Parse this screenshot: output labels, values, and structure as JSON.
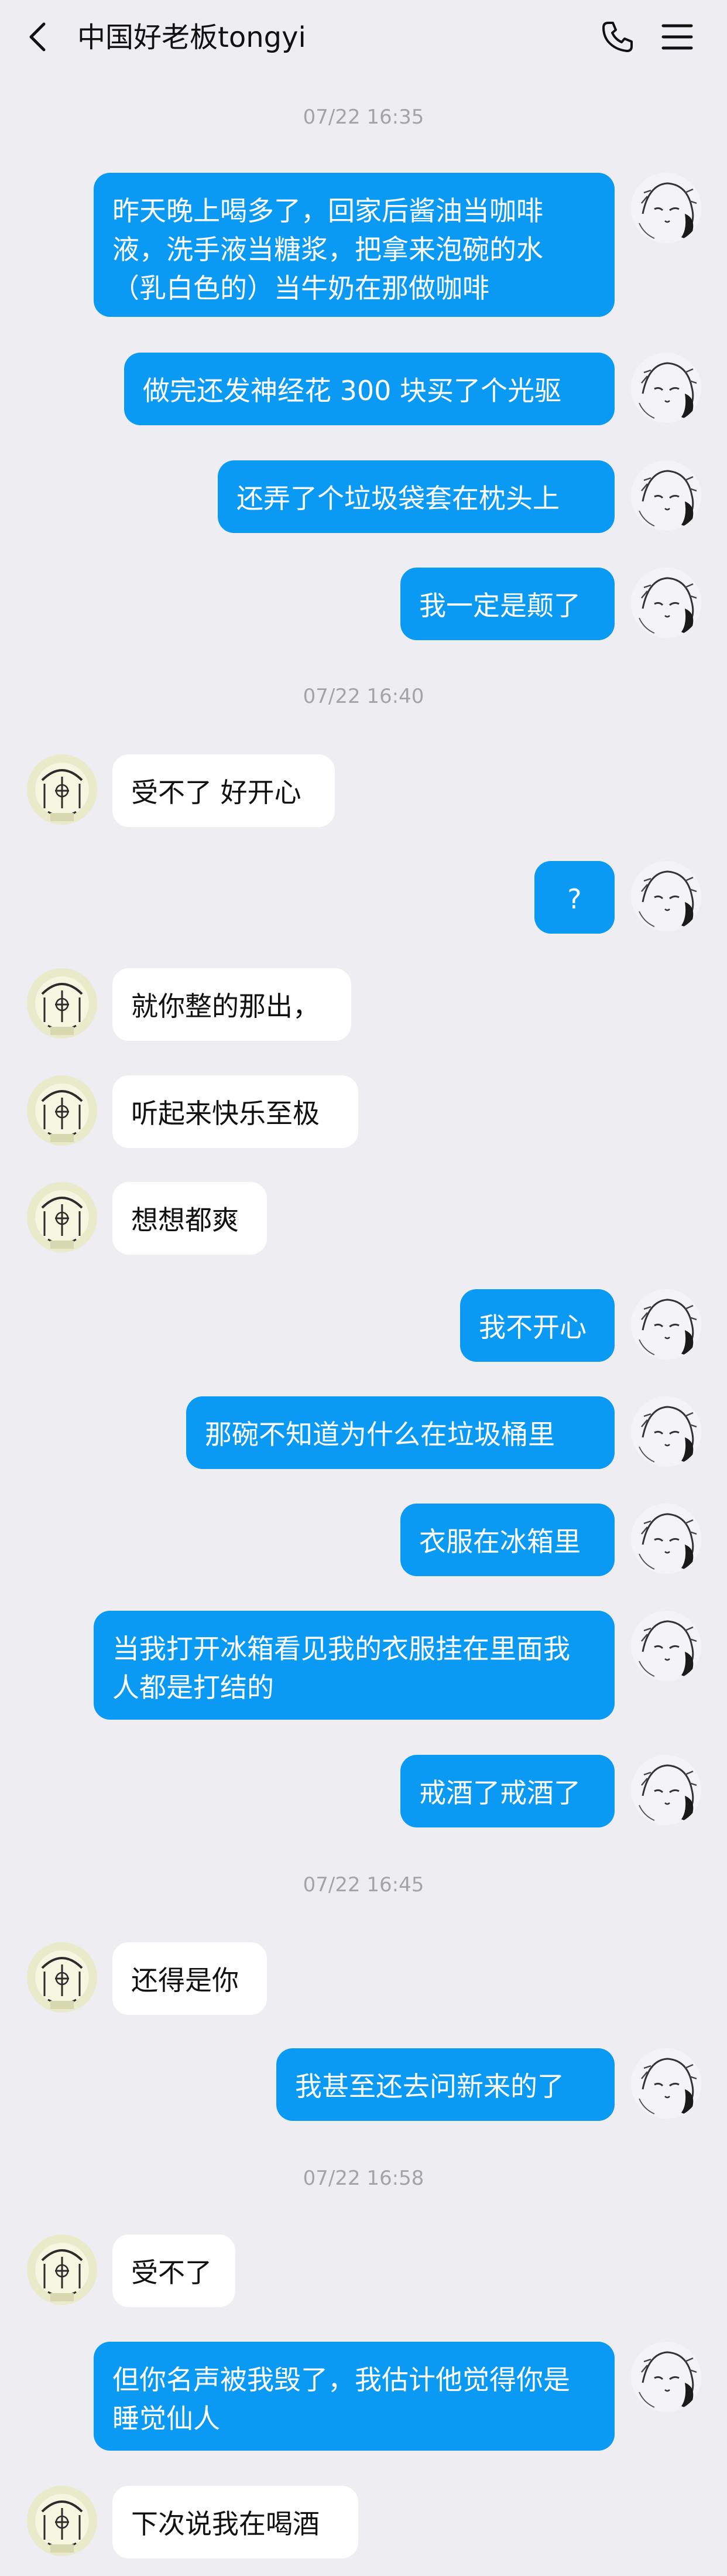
{
  "header": {
    "title": "中国好老板tongyi",
    "back_icon": "chevron-left-icon",
    "phone_icon": "phone-icon",
    "menu_icon": "menu-icon"
  },
  "colors": {
    "background": "#EDEDF2",
    "outgoing_bubble": "#0A9AF4",
    "incoming_bubble": "#FFFFFF",
    "timestamp_text": "#A3A3AA"
  },
  "messages": [
    {
      "type": "time",
      "text": "07/22 16:35"
    },
    {
      "type": "msg",
      "side": "right",
      "text": "昨天晚上喝多了，回家后酱油当咖啡液，洗手液当糖浆，把拿来泡碗的水（乳白色的）当牛奶在那做咖啡"
    },
    {
      "type": "msg",
      "side": "right",
      "text": "做完还发神经花 300 块买了个光驱"
    },
    {
      "type": "msg",
      "side": "right",
      "text": "还弄了个垃圾袋套在枕头上"
    },
    {
      "type": "msg",
      "side": "right",
      "text": "我一定是颠了"
    },
    {
      "type": "time",
      "text": "07/22 16:40"
    },
    {
      "type": "msg",
      "side": "left",
      "text": "受不了 好开心"
    },
    {
      "type": "msg",
      "side": "right",
      "text": "?"
    },
    {
      "type": "msg",
      "side": "left",
      "text": "就你整的那出，"
    },
    {
      "type": "msg",
      "side": "left",
      "text": "听起来快乐至极"
    },
    {
      "type": "msg",
      "side": "left",
      "text": "想想都爽"
    },
    {
      "type": "msg",
      "side": "right",
      "text": "我不开心"
    },
    {
      "type": "msg",
      "side": "right",
      "text": "那碗不知道为什么在垃圾桶里"
    },
    {
      "type": "msg",
      "side": "right",
      "text": "衣服在冰箱里"
    },
    {
      "type": "msg",
      "side": "right",
      "text": "当我打开冰箱看见我的衣服挂在里面我人都是打结的"
    },
    {
      "type": "msg",
      "side": "right",
      "text": "戒酒了戒酒了"
    },
    {
      "type": "time",
      "text": "07/22 16:45"
    },
    {
      "type": "msg",
      "side": "left",
      "text": "还得是你"
    },
    {
      "type": "msg",
      "side": "right",
      "text": "我甚至还去问新来的了"
    },
    {
      "type": "time",
      "text": "07/22 16:58"
    },
    {
      "type": "msg",
      "side": "left",
      "text": "受不了"
    },
    {
      "type": "msg",
      "side": "right",
      "text": "但你名声被我毁了，我估计他觉得你是睡觉仙人"
    },
    {
      "type": "msg",
      "side": "left",
      "text": "下次说我在喝酒"
    }
  ]
}
